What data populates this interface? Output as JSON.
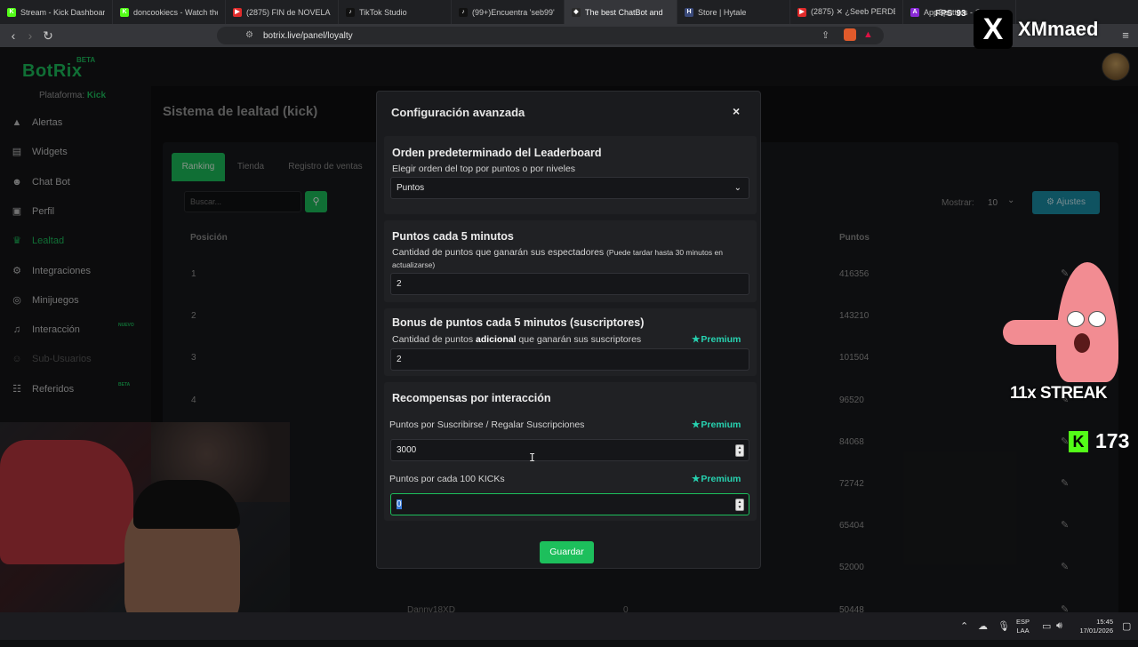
{
  "browser": {
    "tabs": [
      {
        "label": "Stream - Kick Dashboard",
        "fav_color": "#53fc18",
        "fav_char": "K",
        "active": false
      },
      {
        "label": "doncookiecs - Watch the V",
        "fav_color": "#53fc18",
        "fav_char": "K",
        "active": false
      },
      {
        "label": "(2875) FIN de NOVELA",
        "fav_color": "#e02b2b",
        "fav_char": "▶",
        "active": false
      },
      {
        "label": "TikTok Studio",
        "fav_color": "#111111",
        "fav_char": "♪",
        "active": false
      },
      {
        "label": "(99+)Encuentra 'seb99' en",
        "fav_color": "#111111",
        "fav_char": "♪",
        "active": false
      },
      {
        "label": "The best ChatBot and",
        "fav_color": "#2a2a2a",
        "fav_char": "◆",
        "active": true
      },
      {
        "label": "Store | Hytale",
        "fav_color": "#3a4a7a",
        "fav_char": "H",
        "active": false
      },
      {
        "label": "(2875) ✕ ¿Seeb PERDE",
        "fav_color": "#e02b2b",
        "fav_char": "▶",
        "active": false
      },
      {
        "label": "AppSpotters - C",
        "fav_color": "#8a2ad6",
        "fav_char": "A",
        "active": false
      }
    ],
    "fps_label": "FPS",
    "fps_value": "93",
    "url": "botrix.live/panel/loyalty"
  },
  "overlay": {
    "x_logo": "X",
    "x_name": "XMmaed",
    "streak": "11x STREAK",
    "kick_logo": "K",
    "kick_count": "173"
  },
  "app": {
    "logo": "BotRix",
    "beta": "BETA",
    "platform_label": "Plataforma:",
    "platform_value": "Kick"
  },
  "sidebar": {
    "items": [
      {
        "label": "Alertas",
        "icon": "warning-icon",
        "glyph": "▲",
        "state": "normal"
      },
      {
        "label": "Widgets",
        "icon": "widgets-icon",
        "glyph": "▤",
        "state": "normal"
      },
      {
        "label": "Chat Bot",
        "icon": "robot-icon",
        "glyph": "☻",
        "state": "normal"
      },
      {
        "label": "Perfil",
        "icon": "profile-card-icon",
        "glyph": "▣",
        "state": "normal"
      },
      {
        "label": "Lealtad",
        "icon": "trophy-icon",
        "glyph": "♛",
        "state": "active"
      },
      {
        "label": "Integraciones",
        "icon": "plug-icon",
        "glyph": "⚙",
        "state": "normal"
      },
      {
        "label": "Minijuegos",
        "icon": "gamepad-icon",
        "glyph": "◎",
        "state": "normal"
      },
      {
        "label": "Interacción",
        "icon": "music-icon",
        "glyph": "♫",
        "state": "normal",
        "badge": "NUEVO"
      },
      {
        "label": "Sub-Usuarios",
        "icon": "users-icon",
        "glyph": "☺",
        "state": "disabled"
      },
      {
        "label": "Referidos",
        "icon": "referral-icon",
        "glyph": "☷",
        "state": "normal",
        "badge": "BETA"
      }
    ]
  },
  "page": {
    "title": "Sistema de lealtad (kick)",
    "tabs": [
      "Ranking",
      "Tienda",
      "Registro de ventas"
    ],
    "search_placeholder": "Buscar...",
    "show_label": "Mostrar:",
    "show_value": "10",
    "settings_label": "Ajustes",
    "col_position": "Posición",
    "col_points": "Puntos",
    "rows": [
      {
        "pos": "1",
        "points": "416356",
        "user": "",
        "value": ""
      },
      {
        "pos": "2",
        "points": "143210",
        "user": "",
        "value": ""
      },
      {
        "pos": "3",
        "points": "101504",
        "user": "",
        "value": ""
      },
      {
        "pos": "4",
        "points": "96520",
        "user": "",
        "value": ""
      },
      {
        "pos": "",
        "points": "84068",
        "user": "",
        "value": ""
      },
      {
        "pos": "",
        "points": "72742",
        "user": "",
        "value": ""
      },
      {
        "pos": "",
        "points": "65404",
        "user": "",
        "value": ""
      },
      {
        "pos": "",
        "points": "52000",
        "user": "",
        "value": ""
      },
      {
        "pos": "",
        "points": "50448",
        "user": "Danny18XD",
        "value": "0"
      }
    ]
  },
  "modal": {
    "title": "Configuración avanzada",
    "close": "×",
    "leaderboard": {
      "title": "Orden predeterminado del Leaderboard",
      "desc": "Elegir orden del top por puntos o por niveles",
      "select_value": "Puntos"
    },
    "points5": {
      "title": "Puntos cada 5 minutos",
      "desc_main": "Cantidad de puntos que ganarán sus espectadores ",
      "desc_small": "(Puede tardar hasta 30 minutos en actualizarse)",
      "value": "2"
    },
    "bonus": {
      "title": "Bonus de puntos cada 5 minutos (suscriptores)",
      "desc_pre": "Cantidad de puntos ",
      "desc_bold": "adicional",
      "desc_post": " que ganarán sus suscriptores",
      "premium": "Premium",
      "value": "2"
    },
    "rewards": {
      "title": "Recompensas por interacción",
      "sub_label": "Puntos por Suscribirse / Regalar Suscripciones",
      "sub_premium": "Premium",
      "sub_value": "3000",
      "kicks_label": "Puntos por cada 100 KICKs",
      "kicks_premium": "Premium",
      "kicks_value": "0"
    },
    "save": "Guardar"
  },
  "taskbar": {
    "lang_1": "ESP",
    "lang_2": "LAA",
    "time": "15:45",
    "date": "17/01/2026"
  }
}
